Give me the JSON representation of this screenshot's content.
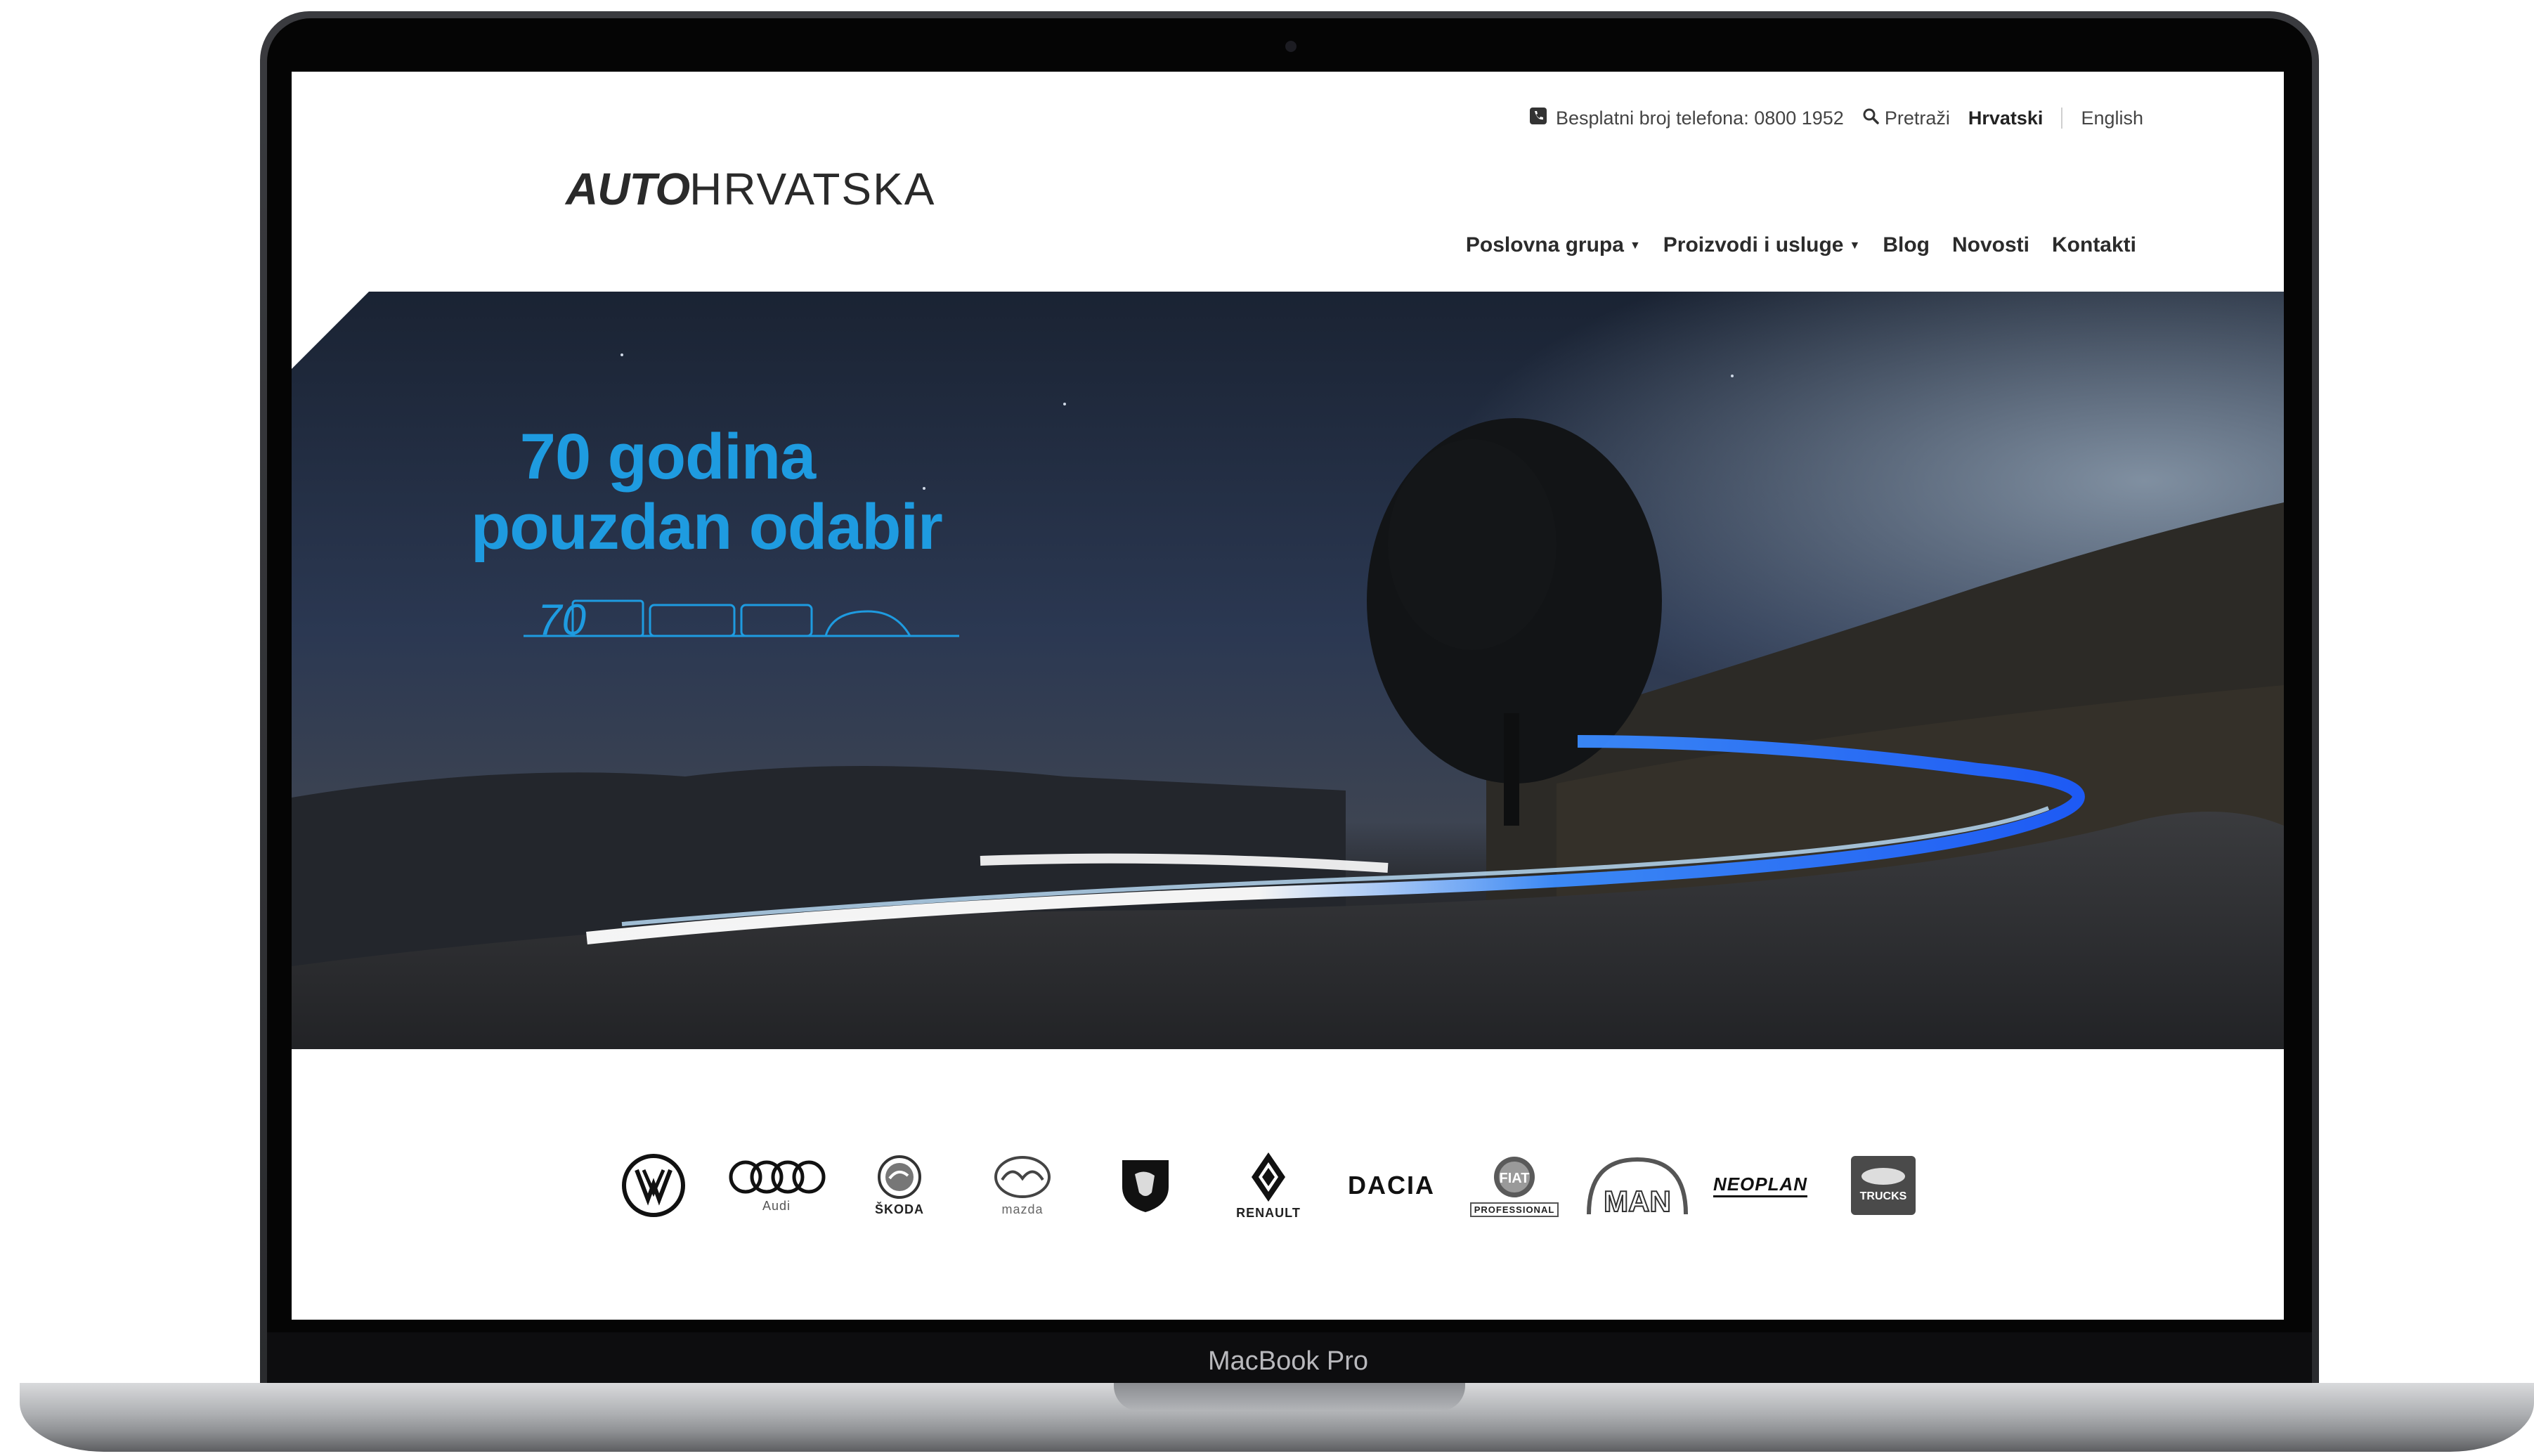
{
  "device": {
    "label": "MacBook Pro"
  },
  "header": {
    "phone_label": "Besplatni broj telefona: 0800 1952",
    "search_label": "Pretraži",
    "language_active": "Hrvatski",
    "language_alt": "English",
    "logo_bold": "AUTO",
    "logo_light": "HRVATSKA"
  },
  "nav": {
    "items": [
      {
        "label": "Poslovna grupa",
        "dropdown": true
      },
      {
        "label": "Proizvodi i usluge",
        "dropdown": true
      },
      {
        "label": "Blog",
        "dropdown": false
      },
      {
        "label": "Novosti",
        "dropdown": false
      },
      {
        "label": "Kontakti",
        "dropdown": false
      }
    ]
  },
  "hero": {
    "line1": "70 godina",
    "line2": "pouzdan odabir",
    "badge": "70",
    "accent_color": "#1e9be0"
  },
  "brands": [
    {
      "name": "Volkswagen",
      "icon": "vw-logo-icon",
      "caption": ""
    },
    {
      "name": "Audi",
      "icon": "audi-logo-icon",
      "caption": "Audi"
    },
    {
      "name": "Škoda",
      "icon": "skoda-logo-icon",
      "caption": "ŠKODA"
    },
    {
      "name": "Mazda",
      "icon": "mazda-logo-icon",
      "caption": "mazda"
    },
    {
      "name": "Peugeot",
      "icon": "peugeot-logo-icon",
      "caption": ""
    },
    {
      "name": "Renault",
      "icon": "renault-logo-icon",
      "caption": "RENAULT"
    },
    {
      "name": "Dacia",
      "icon": "dacia-logo-icon",
      "caption": "DACIA"
    },
    {
      "name": "Fiat Professional",
      "icon": "fiat-logo-icon",
      "caption": "PROFESSIONAL"
    },
    {
      "name": "MAN",
      "icon": "man-logo-icon",
      "caption": "MAN"
    },
    {
      "name": "Neoplan",
      "icon": "neoplan-logo-icon",
      "caption": "NEOPLAN"
    },
    {
      "name": "Ford Trucks",
      "icon": "ford-trucks-logo-icon",
      "caption": "TRUCKS"
    }
  ]
}
